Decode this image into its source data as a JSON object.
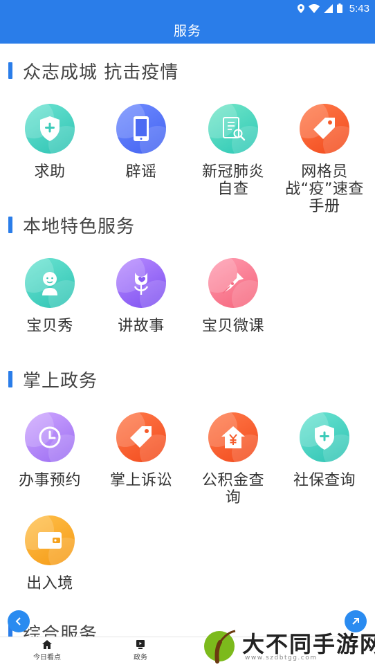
{
  "status_bar": {
    "time": "5:43",
    "icons": [
      "location-icon",
      "wifi-icon",
      "signal-icon",
      "battery-icon"
    ],
    "color": "#2a7de9"
  },
  "app_bar": {
    "title": "服务",
    "color": "#2a7de9"
  },
  "sections": [
    {
      "title": "众志成城 抗击疫情",
      "tiles": [
        {
          "label": "求助",
          "icon": "shield-plus-icon"
        },
        {
          "label": "辟谣",
          "icon": "phone-icon"
        },
        {
          "label": "新冠肺炎\n自查",
          "icon": "document-search-icon"
        },
        {
          "label": "网格员\n战“疫”速查\n手册",
          "icon": "tag-icon"
        }
      ]
    },
    {
      "title": "本地特色服务",
      "tiles": [
        {
          "label": "宝贝秀",
          "icon": "baby-icon"
        },
        {
          "label": "讲故事",
          "icon": "flower-icon"
        },
        {
          "label": "宝贝微课",
          "icon": "pen-nib-icon"
        }
      ]
    },
    {
      "title": "掌上政务",
      "tiles": [
        {
          "label": "办事预约",
          "icon": "clock-icon"
        },
        {
          "label": "掌上诉讼",
          "icon": "tag-icon"
        },
        {
          "label": "公积金查\n询",
          "icon": "house-yuan-icon"
        },
        {
          "label": "社保查询",
          "icon": "shield-plus-icon"
        },
        {
          "label": "出入境",
          "icon": "wallet-icon"
        }
      ]
    },
    {
      "title": "综合服务",
      "tiles": []
    }
  ],
  "bottom_nav": [
    {
      "label": "今日看点",
      "icon": "home-icon"
    },
    {
      "label": "政务",
      "icon": "tv-icon"
    }
  ],
  "watermark": {
    "text": "大不同手游网",
    "url": "www.szdbtgg.com"
  }
}
